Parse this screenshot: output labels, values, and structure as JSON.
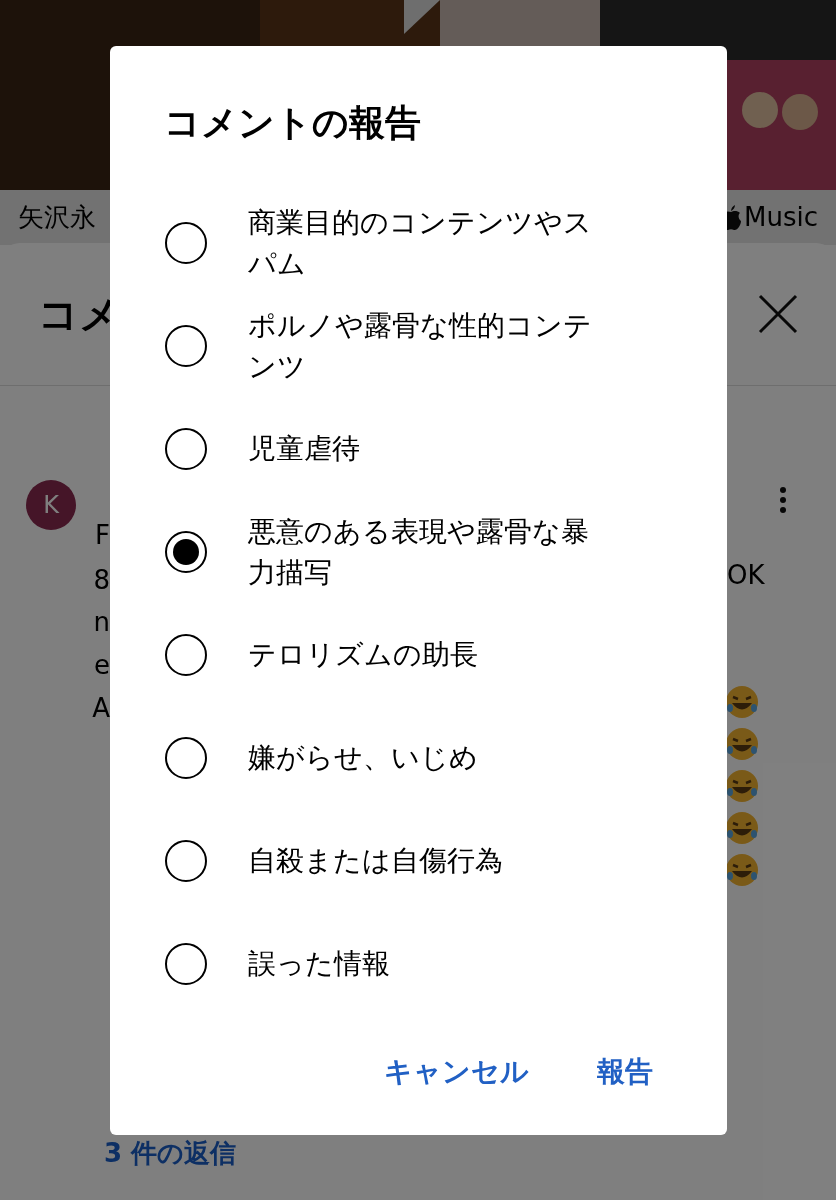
{
  "ad_strip": {
    "title": "矢沢永",
    "brand": "Music"
  },
  "comments_panel": {
    "title": "コメ",
    "comment": {
      "avatar": "K",
      "line_fragments": [
        "F",
        "8",
        "n",
        "e",
        "A"
      ],
      "trailing_text": "OK",
      "replies_link": "3 件の返信"
    }
  },
  "dialog": {
    "title": "コメントの報告",
    "options": [
      {
        "label": "商業目的のコンテンツやスパム",
        "selected": false
      },
      {
        "label": "ポルノや露骨な性的コンテンツ",
        "selected": false
      },
      {
        "label": "児童虐待",
        "selected": false
      },
      {
        "label": "悪意のある表現や露骨な暴力描写",
        "selected": true
      },
      {
        "label": "テロリズムの助長",
        "selected": false
      },
      {
        "label": "嫌がらせ、いじめ",
        "selected": false
      },
      {
        "label": "自殺または自傷行為",
        "selected": false
      },
      {
        "label": "誤った情報",
        "selected": false
      }
    ],
    "buttons": [
      {
        "label": "キャンセル"
      },
      {
        "label": "報告"
      }
    ]
  }
}
